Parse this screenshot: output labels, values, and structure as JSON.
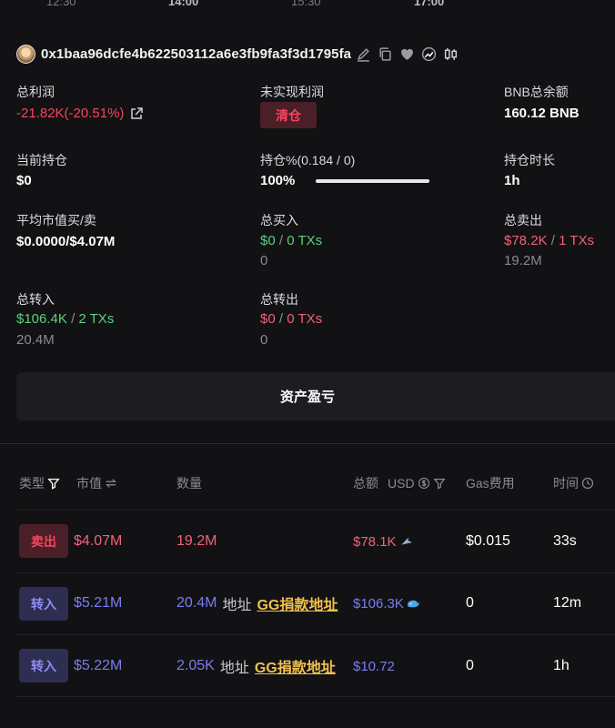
{
  "time_axis": [
    "12:30",
    "14:00",
    "15:30",
    "17:00"
  ],
  "wallet": {
    "address": "0x1baa96dcfe4b622503112a6e3fb9fa3f3d1795fa"
  },
  "stats": {
    "total_profit": {
      "label": "总利润",
      "value": "-21.82K(-20.51%)"
    },
    "unrealized_profit": {
      "label": "未实现利润",
      "badge": "清仓"
    },
    "bnb_balance": {
      "label": "BNB总余额",
      "value": "160.12 BNB"
    },
    "current_position": {
      "label": "当前持仓",
      "value": "$0"
    },
    "position_pct": {
      "label": "持仓%(0.184 / 0)",
      "value": "100%",
      "progress": 1.0
    },
    "hold_duration": {
      "label": "持仓时长",
      "value": "1h"
    },
    "avg_mcap": {
      "label": "平均市值买/卖",
      "value": "$0.0000/$4.07M"
    },
    "total_buy": {
      "label": "总买入",
      "amount": "$0",
      "sep": "/",
      "txs": "0 TXs",
      "sub": "0"
    },
    "total_sell": {
      "label": "总卖出",
      "amount": "$78.2K",
      "sep": "/",
      "txs": "1 TXs",
      "sub": "19.2M"
    },
    "total_in": {
      "label": "总转入",
      "amount": "$106.4K",
      "sep": "/",
      "txs": "2 TXs",
      "sub": "20.4M"
    },
    "total_out": {
      "label": "总转出",
      "amount": "$0",
      "sep": "/",
      "txs": "0 TXs",
      "sub": "0"
    }
  },
  "asset_pnl_button": "资产盈亏",
  "table": {
    "headers": {
      "type": "类型",
      "mcap": "市值",
      "qty": "数量",
      "total": "总额",
      "usd": "USD",
      "gas": "Gas费用",
      "time": "时间"
    },
    "rows": [
      {
        "type": "卖出",
        "mcap": "$4.07M",
        "qty": "19.2M",
        "addr_label": "",
        "addr": "",
        "total": "$78.1K",
        "gas": "$0.015",
        "time": "33s"
      },
      {
        "type": "转入",
        "mcap": "$5.21M",
        "qty": "20.4M",
        "addr_label": "地址",
        "addr": "GG捐款地址",
        "total": "$106.3K",
        "gas": "0",
        "time": "12m"
      },
      {
        "type": "转入",
        "mcap": "$5.22M",
        "qty": "2.05K",
        "addr_label": "地址",
        "addr": "GG捐款地址",
        "total": "$10.72",
        "gas": "0",
        "time": "1h"
      }
    ]
  },
  "colors": {
    "red": "#f6465d",
    "green": "#2ebd85",
    "purple": "#7b7bf2",
    "link": "#f0c04e"
  }
}
